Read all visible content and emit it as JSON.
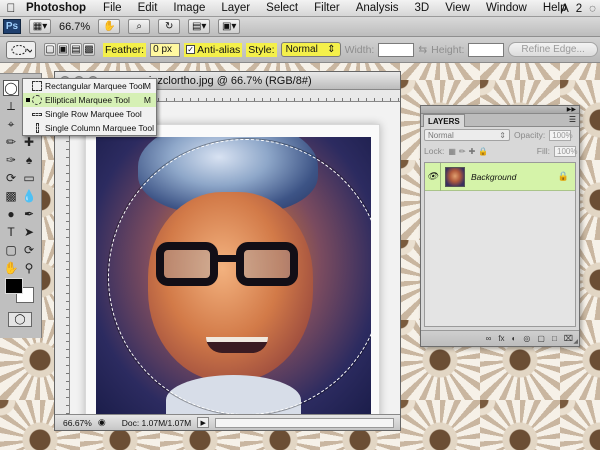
{
  "menubar": {
    "apple": "",
    "app_name": "Photoshop",
    "items": [
      "File",
      "Edit",
      "Image",
      "Layer",
      "Select",
      "Filter",
      "Analysis",
      "3D",
      "View",
      "Window",
      "Help"
    ],
    "right_a": "A",
    "right_b": "2",
    "right_c": "◌"
  },
  "appbar": {
    "ps_logo": "Ps",
    "zoom": "66.7%",
    "buttons": [
      "▦▾",
      "✋",
      "⌕",
      "↻",
      "▤▾",
      "▣▾"
    ]
  },
  "options": {
    "feather_label": "Feather:",
    "feather_value": "0 px",
    "antialias_label": "Anti-alias",
    "style_label": "Style:",
    "style_value": "Normal",
    "width_label": "Width:",
    "height_label": "Height:",
    "refine_label": "Refine Edge..."
  },
  "flyout": {
    "items": [
      {
        "label": "Rectangular Marquee Tool",
        "key": "M"
      },
      {
        "label": "Elliptical Marquee Tool",
        "key": "M"
      },
      {
        "label": "Single Row Marquee Tool",
        "key": ""
      },
      {
        "label": "Single Column Marquee Tool",
        "key": ""
      }
    ]
  },
  "document": {
    "title": "vinzclortho.jpg @ 66.7% (RGB/8#)",
    "zoom": "66.67%",
    "doc_info": "Doc: 1.07M/1.07M"
  },
  "layers": {
    "tab": "LAYERS",
    "blend_mode": "Normal",
    "opacity_label": "Opacity:",
    "opacity_value": "100%",
    "lock_label": "Lock:",
    "fill_label": "Fill:",
    "fill_value": "100%",
    "layer_name": "Background",
    "bottom_icons": [
      "∞",
      "fx",
      "◐",
      "◎",
      "▢",
      "□",
      "⌧"
    ]
  }
}
